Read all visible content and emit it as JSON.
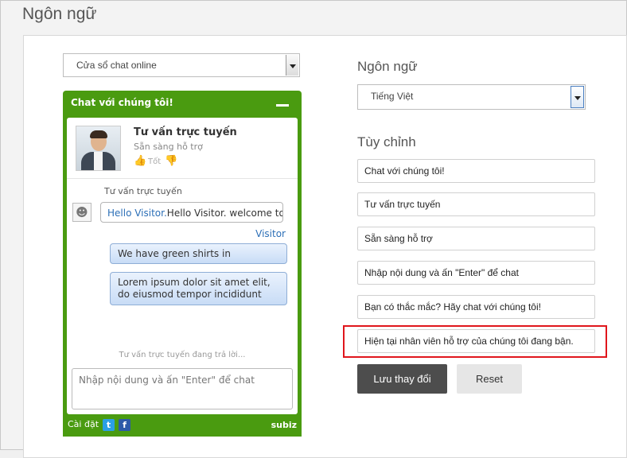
{
  "page": {
    "title": "Ngôn ngữ"
  },
  "widget_select": {
    "value": "Cửa sổ chat online"
  },
  "widget": {
    "title": "Chat với chúng tôi!",
    "agent_name": "Tư vấn trực tuyến",
    "agent_status": "Sẵn sàng hỗ trợ",
    "rating_label": "Tốt",
    "sender_label": "Tư vấn trực tuyến",
    "incoming_name": "Hello Visitor.",
    "incoming_text": "Hello Visitor. welcome to",
    "visitor_label": "Visitor",
    "outgoing_1": "We have green shirts in",
    "outgoing_2": "Lorem ipsum dolor sit amet elit, do eiusmod tempor incididunt",
    "typing": "Tư vấn trực tuyến đang trả lời...",
    "input_placeholder": "Nhập nội dung và ấn \"Enter\" để chat",
    "footer_settings": "Cài đặt",
    "brand": "subiz"
  },
  "language": {
    "heading": "Ngôn ngữ",
    "value": "Tiếng Việt"
  },
  "custom": {
    "heading": "Tùy chỉnh",
    "fields": [
      "Chat với chúng tôi!",
      "Tư vấn trực tuyến",
      "Sẵn sàng hỗ trợ",
      "Nhập nội dung và ấn \"Enter\" để chat",
      "Bạn có thắc mắc? Hãy chat với chúng tôi!",
      "Hiện tại nhân viên hỗ trợ của chúng tôi đang bận."
    ]
  },
  "actions": {
    "save": "Lưu thay đổi",
    "reset": "Reset"
  },
  "colors": {
    "widget_green": "#4a9b10",
    "highlight_red": "#e0161c",
    "save_bg": "#4d4d4d"
  }
}
